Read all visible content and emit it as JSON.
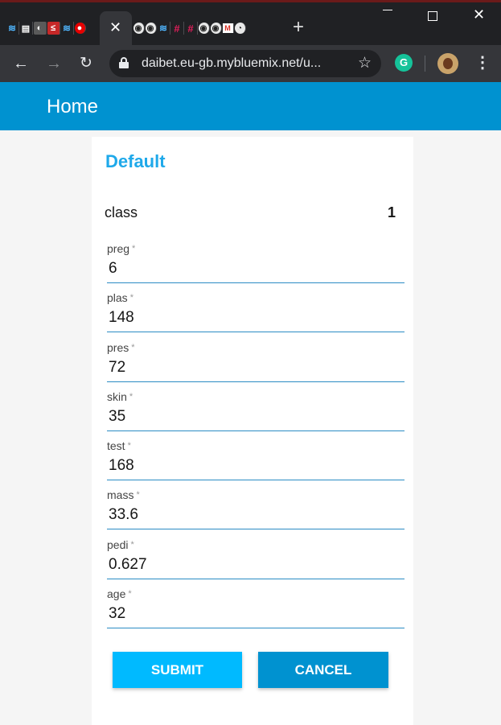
{
  "browser": {
    "url": "daibet.eu-gb.mybluemix.net/u...",
    "close_tab_symbol": "✕",
    "new_tab_symbol": "+",
    "grammarly_letter": "G"
  },
  "app": {
    "title": "Home"
  },
  "form": {
    "title": "Default",
    "class_label": "class",
    "class_value": "1",
    "fields": [
      {
        "label": "preg",
        "value": "6"
      },
      {
        "label": "plas",
        "value": "148"
      },
      {
        "label": "pres",
        "value": "72"
      },
      {
        "label": "skin",
        "value": "35"
      },
      {
        "label": "test",
        "value": "168"
      },
      {
        "label": "mass",
        "value": "33.6"
      },
      {
        "label": "pedi",
        "value": "0.627"
      },
      {
        "label": "age",
        "value": "32"
      }
    ],
    "required_marker": "*",
    "submit_label": "SUBMIT",
    "cancel_label": "CANCEL"
  },
  "colors": {
    "header": "#0092d0",
    "title_accent": "#1fa9ea",
    "submit": "#00baff",
    "cancel": "#0092d0"
  }
}
